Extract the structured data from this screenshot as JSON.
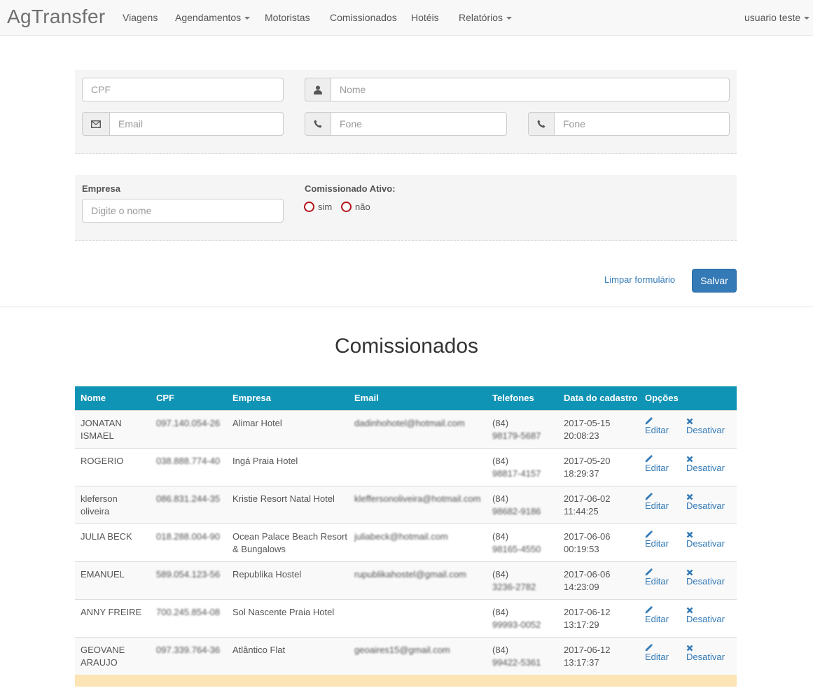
{
  "navbar": {
    "brand": "AgTransfer",
    "items": [
      {
        "label": "Viagens",
        "dropdown": false
      },
      {
        "label": "Agendamentos",
        "dropdown": true
      },
      {
        "label": "Motoristas",
        "dropdown": false
      },
      {
        "label": "Comissionados",
        "dropdown": false
      },
      {
        "label": "Hotéis",
        "dropdown": false
      },
      {
        "label": "Relatórios",
        "dropdown": true
      }
    ],
    "user": "usuario teste"
  },
  "form": {
    "cpf_placeholder": "CPF",
    "nome_placeholder": "Nome",
    "email_placeholder": "Email",
    "fone1_placeholder": "Fone",
    "fone2_placeholder": "Fone",
    "empresa_label": "Empresa",
    "empresa_placeholder": "Digite o nome",
    "ativo_label": "Comissionado Ativo:",
    "radio_sim": "sim",
    "radio_nao": "não",
    "clear_label": "Limpar formulário",
    "save_label": "Salvar"
  },
  "page_title": "Comissionados",
  "table": {
    "headers": [
      "Nome",
      "CPF",
      "Empresa",
      "Email",
      "Telefones",
      "Data do cadastro",
      "Opções"
    ],
    "edit_label": "Editar",
    "deactivate_label": "Desativar",
    "rows": [
      {
        "nome": [
          "JONATAN",
          "ISMAEL"
        ],
        "cpf": "097.140.054-26",
        "empresa": [
          "Alimar Hotel"
        ],
        "email": "dadinhohotel@hotmail.com",
        "tel": [
          "(84)",
          "98179-5687"
        ],
        "data": [
          "2017-05-15",
          "20:08:23"
        ]
      },
      {
        "nome": [
          "ROGERIO"
        ],
        "cpf": "038.888.774-40",
        "empresa": [
          "Ingá Praia Hotel"
        ],
        "email": "",
        "tel": [
          "(84)",
          "98817-4157"
        ],
        "data": [
          "2017-05-20",
          "18:29:37"
        ]
      },
      {
        "nome": [
          "kleferson",
          "oliveira"
        ],
        "cpf": "086.831.244-35",
        "empresa": [
          "Kristie Resort Natal Hotel"
        ],
        "email": "kleffersonoliveira@hotmail.com",
        "tel": [
          "(84)",
          "98682-9186"
        ],
        "data": [
          "2017-06-02",
          "11:44:25"
        ]
      },
      {
        "nome": [
          "JULIA BECK"
        ],
        "cpf": "018.288.004-90",
        "empresa": [
          "Ocean Palace Beach Resort",
          "& Bungalows"
        ],
        "email": "juliabeck@hotmail.com",
        "tel": [
          "(84)",
          "98165-4550"
        ],
        "data": [
          "2017-06-06",
          "00:19:53"
        ]
      },
      {
        "nome": [
          "EMANUEL"
        ],
        "cpf": "589.054.123-56",
        "empresa": [
          "Republika Hostel"
        ],
        "email": "rupublikahostel@gmail.com",
        "tel": [
          "(84)",
          "3236-2782"
        ],
        "data": [
          "2017-06-06",
          "14:23:09"
        ]
      },
      {
        "nome": [
          "ANNY FREIRE"
        ],
        "cpf": "700.245.854-08",
        "empresa": [
          "Sol Nascente Praia Hotel"
        ],
        "email": "",
        "tel": [
          "(84)",
          "99993-0052"
        ],
        "data": [
          "2017-06-12",
          "13:17:29"
        ]
      },
      {
        "nome": [
          "GEOVANE",
          "ARAUJO"
        ],
        "cpf": "097.339.764-36",
        "empresa": [
          "Atlântico Flat"
        ],
        "email": "geoaires15@gmail.com",
        "tel": [
          "(84)",
          "99422-5361"
        ],
        "data": [
          "2017-06-12",
          "13:17:37"
        ]
      }
    ]
  }
}
